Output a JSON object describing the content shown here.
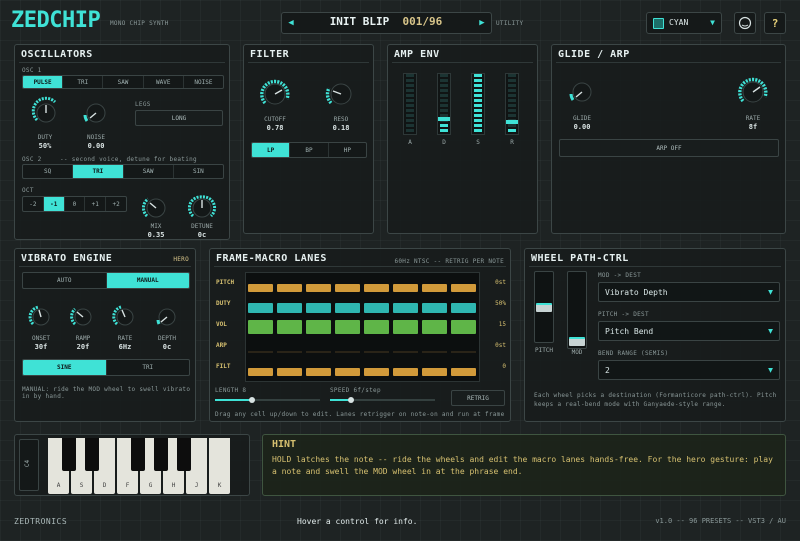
{
  "header": {
    "brand": "ZEDCHIP",
    "subtitle": "MONO CHIP SYNTH",
    "preset_name": "INIT BLIP",
    "preset_index": "001/96",
    "utility_label": "UTILITY",
    "theme_value": "CYAN"
  },
  "oscillators": {
    "title": "OSCILLATORS",
    "osc1_label": "OSC 1",
    "waves": [
      "PULSE",
      "TRI",
      "SAW",
      "WAVE",
      "NOISE"
    ],
    "duty_label": "DUTY",
    "duty_value": "50%",
    "noise_label": "NOISE",
    "noise_value": "0.00",
    "legs_label": "LEGS",
    "legs_value": "LONG",
    "osc2_label": "OSC 2",
    "osc2_note": "-- second voice, detune for beating",
    "osc2_waves": [
      "SQ",
      "TRI",
      "SAW",
      "SIN"
    ],
    "oct_label": "OCT",
    "oct_values": [
      "-2",
      "-1",
      "0",
      "+1",
      "+2"
    ],
    "mix_label": "MIX",
    "mix_value": "0.35",
    "detune_label": "DETUNE",
    "detune_value": "0c"
  },
  "filter": {
    "title": "FILTER",
    "cutoff_label": "CUTOFF",
    "cutoff_value": "0.78",
    "reso_label": "RESO",
    "reso_value": "0.18",
    "modes": [
      "LP",
      "BP",
      "HP"
    ]
  },
  "amp_env": {
    "title": "AMP ENV",
    "labels": [
      "A",
      "D",
      "S",
      "R"
    ],
    "levels": [
      0.0,
      0.2,
      1.0,
      0.15
    ]
  },
  "glide": {
    "title": "GLIDE / ARP",
    "glide_label": "GLIDE",
    "glide_value": "0.00",
    "rate_label": "RATE",
    "rate_value": "8f",
    "arp_button": "ARP OFF"
  },
  "vibrato": {
    "title": "VIBRATO ENGINE",
    "hero_tag": "HERO",
    "modes": [
      "AUTO",
      "MANUAL"
    ],
    "onset_label": "ONSET",
    "onset_value": "30f",
    "ramp_label": "RAMP",
    "ramp_value": "20f",
    "rate_label": "RATE",
    "rate_value": "6Hz",
    "depth_label": "DEPTH",
    "depth_value": "0c",
    "shapes": [
      "SINE",
      "TRI"
    ],
    "note": "MANUAL: ride the MOD wheel to swell vibrato in by hand."
  },
  "lanes": {
    "title": "FRAME-MACRO LANES",
    "info": "60Hz NTSC -- RETRIG PER NOTE",
    "rows": [
      {
        "name": "PITCH",
        "value": "0st",
        "color": "#d19a3a",
        "count": 8
      },
      {
        "name": "DUTY",
        "value": "50%",
        "color": "#2fb7b1",
        "count": 8
      },
      {
        "name": "VOL",
        "value": "15",
        "color": "#5fb548",
        "count": 8
      },
      {
        "name": "ARP",
        "value": "0st",
        "color": "#d19a3a",
        "count": 0
      },
      {
        "name": "FILT",
        "value": "0",
        "color": "#d19a3a",
        "count": 8
      }
    ],
    "length_label": "LENGTH 8",
    "speed_label": "SPEED 6f/step",
    "length_level": 0.35,
    "speed_level": 0.2,
    "retrig_button": "RETRIG",
    "hint": "Drag any cell up/down to edit. Lanes retrigger on note-on and run at frame r."
  },
  "wheel": {
    "title": "WHEEL PATH-CTRL",
    "pitch_label": "PITCH",
    "mod_label": "MOD",
    "mod_dest_label": "MOD -> DEST",
    "mod_dest_value": "Vibrato Depth",
    "pitch_dest_label": "PITCH -> DEST",
    "pitch_dest_value": "Pitch Bend",
    "bend_label": "BEND RANGE (SEMIS)",
    "bend_value": "2",
    "description": "Each wheel picks a destination (Formanticore path-ctrl). Pitch keeps a real-bend mode with Ganyaede-style range."
  },
  "keyboard": {
    "side_label": "C4",
    "white_keys": [
      "A",
      "S",
      "D",
      "F",
      "G",
      "H",
      "J",
      "K"
    ]
  },
  "hint": {
    "title": "HINT",
    "text": "HOLD latches the note -- ride the wheels and edit the macro lanes hands-free. For the hero gesture: play a note and swell the MOD wheel in at the phrase end."
  },
  "footer": {
    "brand": "ZEDTRONICS",
    "status": "Hover a control for info.",
    "version": "v1.0 -- 96 PRESETS -- VST3 / AU"
  },
  "colors": {
    "accent": "#3fe2d6",
    "bg": "#1e2323",
    "amber": "#d19a3a",
    "green": "#5fb548"
  }
}
